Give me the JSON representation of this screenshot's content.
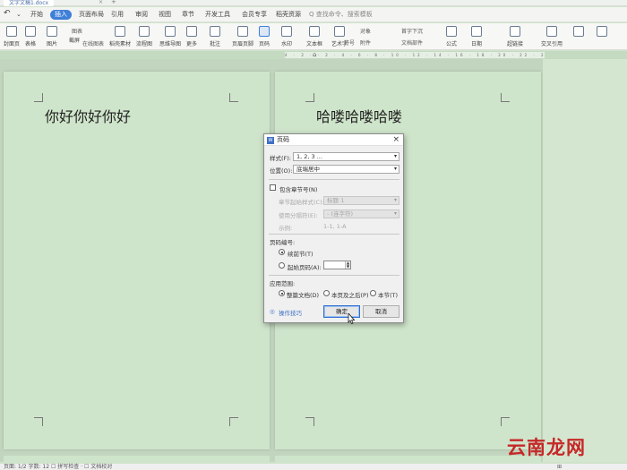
{
  "window": {
    "tab_title": "文字文稿1.docx",
    "tab_close": "×",
    "tab_new": "+"
  },
  "menu": {
    "items": [
      {
        "name": "menu-start",
        "label": "开始"
      },
      {
        "name": "menu-insert",
        "label": "插入"
      },
      {
        "name": "menu-page-layout",
        "label": "页面布局"
      },
      {
        "name": "menu-references",
        "label": "引用"
      },
      {
        "name": "menu-review",
        "label": "审阅"
      },
      {
        "name": "menu-view",
        "label": "视图"
      },
      {
        "name": "menu-section",
        "label": "章节"
      },
      {
        "name": "menu-developer",
        "label": "开发工具"
      },
      {
        "name": "menu-member",
        "label": "会员专享"
      },
      {
        "name": "menu-resources",
        "label": "稻壳资源"
      }
    ],
    "search_placeholder": "Q 查找命令、搜索模板"
  },
  "ribbon": {
    "items": [
      {
        "label": "封面页"
      },
      {
        "label": "表格"
      },
      {
        "label": "图片"
      },
      {
        "label": "截屏"
      },
      {
        "label": "稻壳素材"
      },
      {
        "label": "流程图"
      },
      {
        "label": "思维导图"
      },
      {
        "label": "更多"
      },
      {
        "label": "批注"
      },
      {
        "label": "页眉页脚"
      },
      {
        "label": "页码"
      },
      {
        "label": "水印"
      },
      {
        "label": "文本框"
      },
      {
        "label": "艺术字"
      },
      {
        "label": "符号"
      },
      {
        "label": "公式"
      },
      {
        "label": "超链接"
      },
      {
        "label": "交叉引用"
      }
    ],
    "small": {
      "chart": "图表",
      "online_chart": "在线图表",
      "object": "对象",
      "attachment": "附件",
      "doc_parts": "文档部件",
      "first_letter": "首字下沉",
      "date": "日期"
    }
  },
  "ruler": {
    "ticks": "4 · 2 · · 2 · 4 · 6 · 8 · 10 · 12 · 14 · 16 · 18 · 20 · 22 · 24 · 26 · 28 · 30 · 32 · 34 · 36 · 38 · 40"
  },
  "document": {
    "page1_text": "你好你好你好",
    "page2_text": "哈喽哈喽哈喽"
  },
  "dialog": {
    "icon": "W",
    "title": "页码",
    "close": "×",
    "style_label": "样式(F):",
    "style_value": "1, 2, 3 ...",
    "position_label": "位置(O):",
    "position_value": "底端居中",
    "include_chapter_label": "包含章节号(N)",
    "chapter_start_label": "章节起始样式(C):",
    "chapter_start_value": "标题 1",
    "separator_label": "使用分隔符(E):",
    "separator_value": "- (连字符)",
    "example_label": "示例:",
    "example_value": "1-1, 1-A",
    "numbering_label": "页码编号:",
    "continue_label": "续前节(T)",
    "start_at_label": "起始页码(A):",
    "start_at_value": "",
    "apply_label": "应用范围:",
    "apply_whole": "整篇文档(D)",
    "apply_this_page": "本页及之后(P)",
    "apply_this_section": "本节(T)",
    "tips_link": "操作技巧",
    "ok": "确定",
    "cancel": "取消"
  },
  "statusbar": {
    "left": "页面: 1/2  字数: 12  ☐ 拼写检查 ·  ☐ 文档校对",
    "right": "⊞"
  },
  "watermark": {
    "text": "云南龙网"
  }
}
